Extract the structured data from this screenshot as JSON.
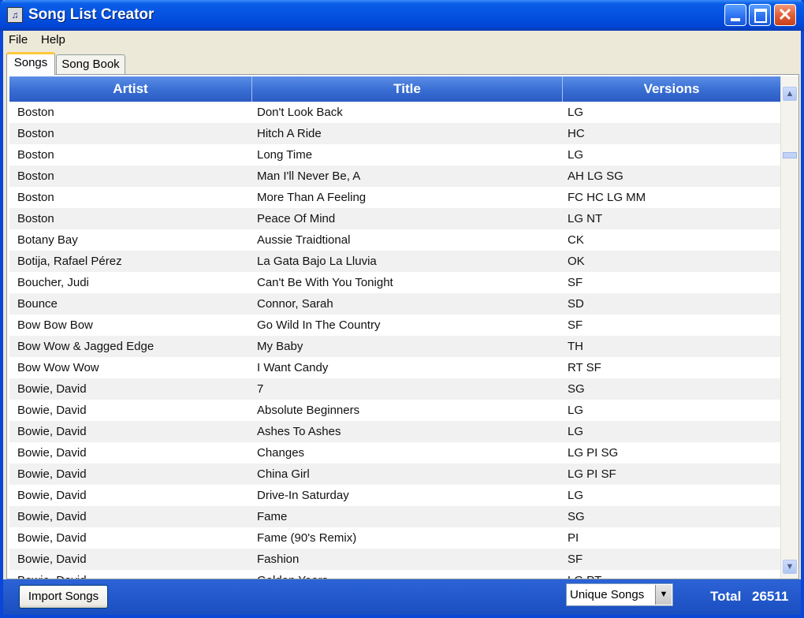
{
  "window": {
    "title": "Song List Creator",
    "icon": "music-note-icon",
    "min_glyph": "",
    "max_glyph": "",
    "close_glyph": "✕"
  },
  "menu": {
    "items": [
      "File",
      "Help"
    ]
  },
  "tabs": [
    {
      "label": "Songs",
      "active": true
    },
    {
      "label": "Song Book",
      "active": false
    }
  ],
  "grid": {
    "columns": [
      "Artist",
      "Title",
      "Versions"
    ],
    "rows": [
      [
        "Boston",
        "Don't Look Back",
        "LG"
      ],
      [
        "Boston",
        "Hitch A Ride",
        "HC"
      ],
      [
        "Boston",
        "Long Time",
        "LG"
      ],
      [
        "Boston",
        "Man I'll Never Be, A",
        "AH LG SG"
      ],
      [
        "Boston",
        "More Than A Feeling",
        "FC HC LG MM"
      ],
      [
        "Boston",
        "Peace Of Mind",
        "LG NT"
      ],
      [
        "Botany Bay",
        "Aussie Traidtional",
        "CK"
      ],
      [
        "Botija, Rafael Pérez",
        "La Gata Bajo La Lluvia",
        "OK"
      ],
      [
        "Boucher, Judi",
        "Can't Be With You Tonight",
        "SF"
      ],
      [
        "Bounce",
        "Connor, Sarah",
        "SD"
      ],
      [
        "Bow Bow Bow",
        "Go Wild In The Country",
        "SF"
      ],
      [
        "Bow Wow & Jagged Edge",
        "My Baby",
        "TH"
      ],
      [
        "Bow Wow Wow",
        "I Want Candy",
        "RT SF"
      ],
      [
        "Bowie, David",
        "7",
        "SG"
      ],
      [
        "Bowie, David",
        "Absolute Beginners",
        "LG"
      ],
      [
        "Bowie, David",
        "Ashes To Ashes",
        "LG"
      ],
      [
        "Bowie, David",
        "Changes",
        "LG PI SG"
      ],
      [
        "Bowie, David",
        "China Girl",
        "LG PI SF"
      ],
      [
        "Bowie, David",
        "Drive-In Saturday",
        "LG"
      ],
      [
        "Bowie, David",
        "Fame",
        "SG"
      ],
      [
        "Bowie, David",
        "Fame (90's Remix)",
        "PI"
      ],
      [
        "Bowie, David",
        "Fashion",
        "SF"
      ],
      [
        "Bowie, David",
        "Golden Years",
        "LG PT"
      ]
    ]
  },
  "scrollbar": {
    "up_glyph": "▲",
    "down_glyph": "▼"
  },
  "footer": {
    "import_label": "Import Songs",
    "filter_value": "Unique Songs",
    "dropdown_glyph": "▼",
    "total_label": "Total",
    "total_value": "26511"
  },
  "colors": {
    "title_bar": "#0551e0",
    "header": "#3a6fd4",
    "footer": "#1f56c8",
    "tab_highlight": "#ffc83c"
  }
}
